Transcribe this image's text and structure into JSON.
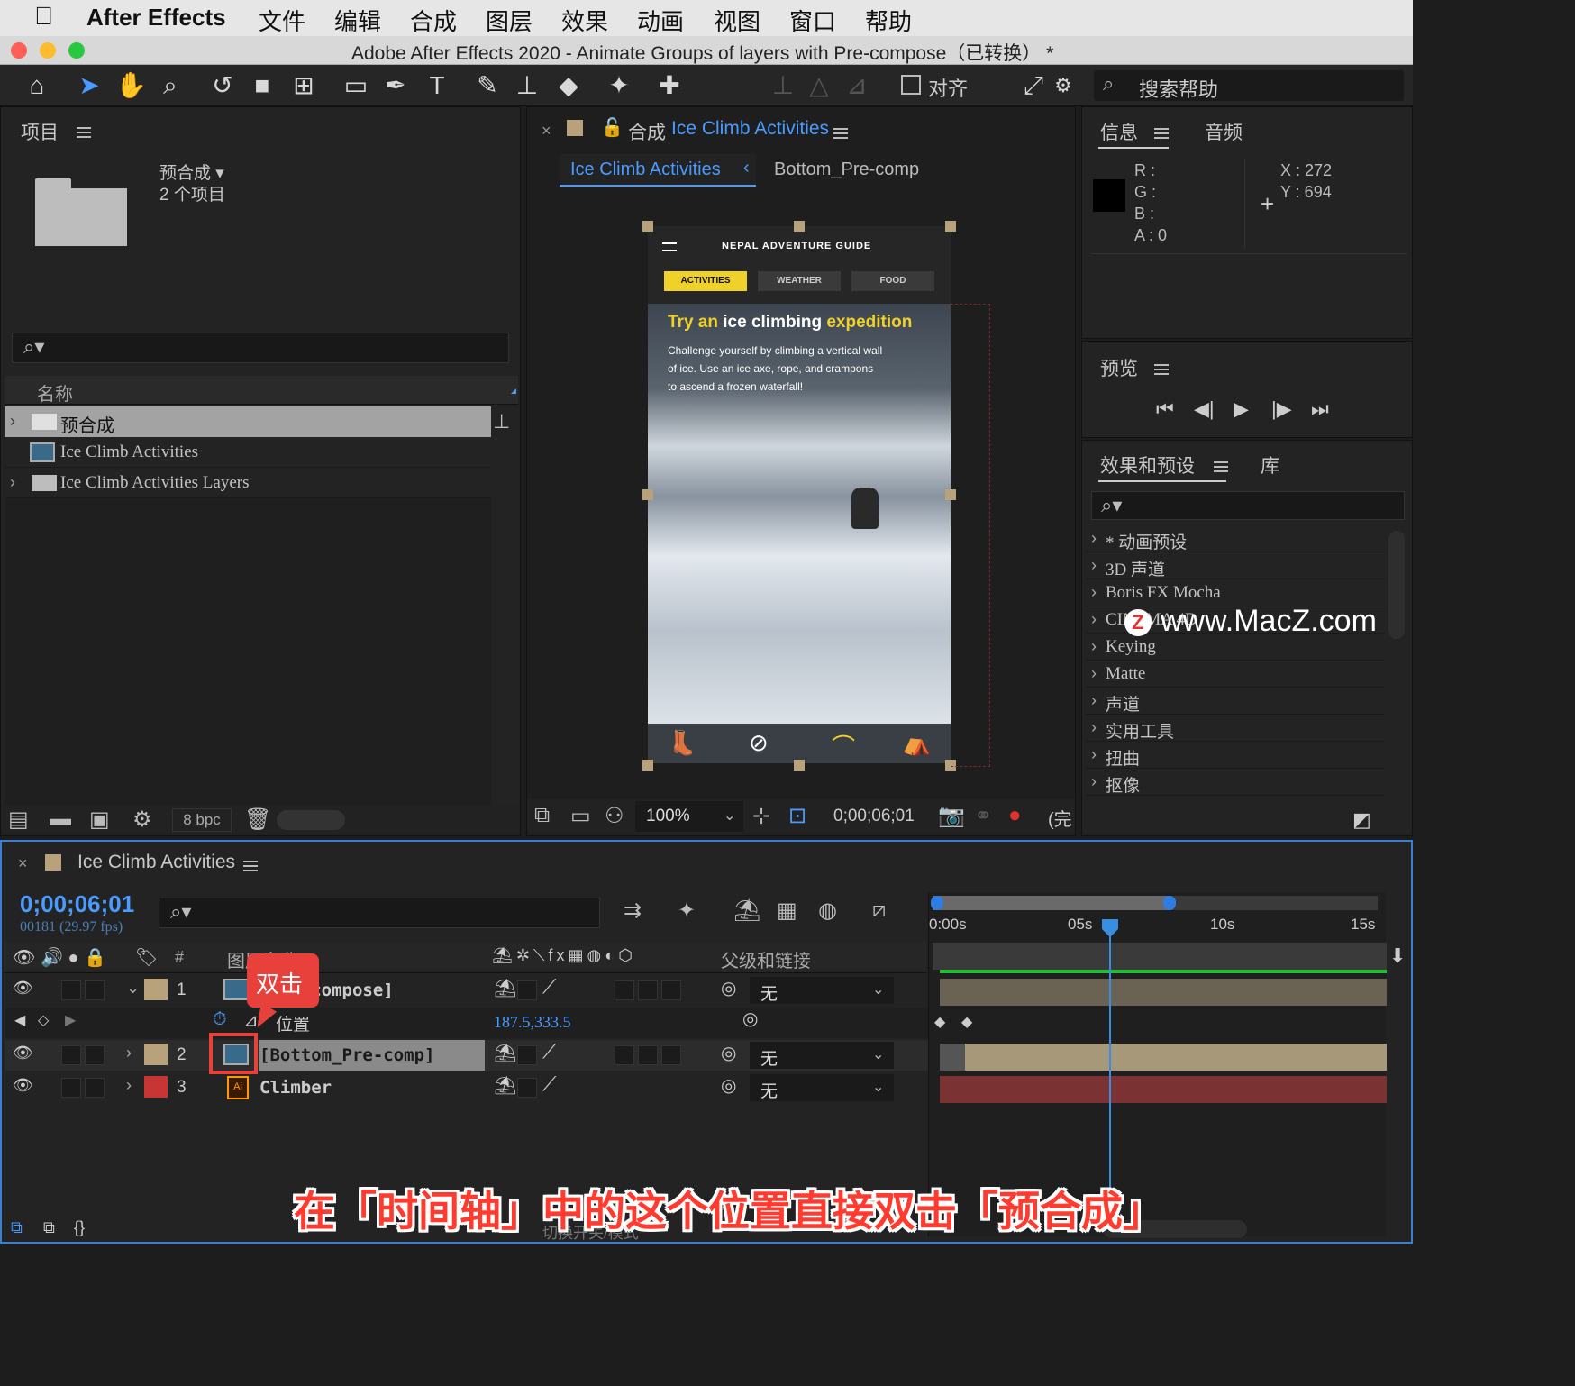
{
  "menubar": {
    "app_name": "After Effects",
    "items": [
      "文件",
      "编辑",
      "合成",
      "图层",
      "效果",
      "动画",
      "视图",
      "窗口",
      "帮助"
    ]
  },
  "window": {
    "title": "Adobe After Effects 2020 - Animate Groups of layers with Pre-compose（已转换） *"
  },
  "toolbar": {
    "align_label": "对齐",
    "search_help_placeholder": "搜索帮助"
  },
  "project_panel": {
    "title": "项目",
    "selected_name": "预合成",
    "selected_count": "2 个项目",
    "column_name": "名称",
    "items": [
      {
        "name": "预合成",
        "type": "folder"
      },
      {
        "name": "Ice Climb Activities",
        "type": "composition"
      },
      {
        "name": "Ice Climb Activities Layers",
        "type": "folder"
      }
    ],
    "bpc": "8 bpc"
  },
  "composition_panel": {
    "title_prefix": "合成",
    "title_comp": "Ice Climb Activities",
    "breadcrumb_active": "Ice Climb Activities",
    "breadcrumb_next": "Bottom_Pre-comp",
    "zoom": "100%",
    "timecode": "0;00;06;01",
    "resolution": "(完"
  },
  "preview_app": {
    "header": "NEPAL ADVENTURE GUIDE",
    "tabs": [
      "ACTIVITIES",
      "WEATHER",
      "FOOD"
    ],
    "headline_1": "Try an",
    "headline_2": "ice climbing",
    "headline_3": "expedition",
    "body_1": "Challenge yourself by climbing a vertical wall",
    "body_2": "of ice. Use an ice axe, rope, and crampons",
    "body_3": "to ascend a frozen waterfall!"
  },
  "info_panel": {
    "tab_active": "信息",
    "tab_other": "音频",
    "r": "R :",
    "g": "G :",
    "b": "B :",
    "a": "A :  0",
    "x": "X : 272",
    "y": "Y :  694"
  },
  "preview_panel": {
    "title": "预览"
  },
  "effects_panel": {
    "tab_active": "效果和预设",
    "tab_other": "库",
    "items": [
      "* 动画预设",
      "3D 声道",
      "Boris FX Mocha",
      "CINEMA 4D",
      "Keying",
      "Matte",
      "声道",
      "实用工具",
      "扭曲",
      "抠像"
    ]
  },
  "watermark": {
    "text": "www.MacZ.com",
    "badge": "Z"
  },
  "timeline_panel": {
    "title": "Ice Climb Activities",
    "timecode": "0;00;06;01",
    "frames": "00181 (29.97 fps)",
    "col_layer_name": "图层名称",
    "col_parent": "父级和链接",
    "ruler": [
      "0:00s",
      "05s",
      "10s",
      "15s"
    ],
    "layers": [
      {
        "index": "1",
        "name": "[Pre-compose]",
        "parent": "无",
        "label_color": "#b8a27c"
      },
      {
        "index": "2",
        "name": "[Bottom_Pre-comp]",
        "parent": "无",
        "label_color": "#b8a27c"
      },
      {
        "index": "3",
        "name": "Climber",
        "parent": "无",
        "label_color": "#c83535"
      }
    ],
    "property_name": "位置",
    "property_value": "187.5,333.5",
    "footer_label": "切换开关/模式"
  },
  "callout": {
    "label": "双击",
    "caption": "在「时间轴」中的这个位置直接双击「预合成」"
  }
}
